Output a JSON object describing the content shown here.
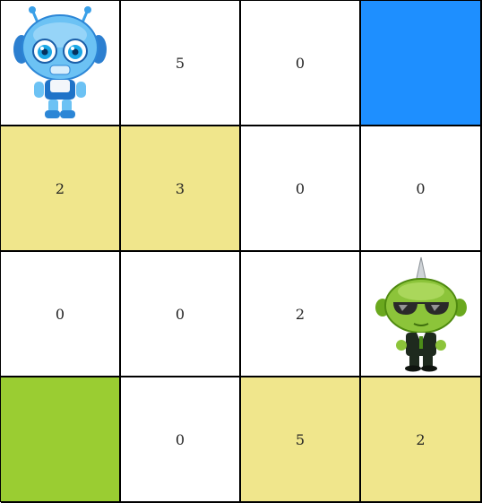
{
  "colors": {
    "white": "#ffffff",
    "sand": "#f0e68c",
    "blue": "#1e8fff",
    "green": "#9acd32"
  },
  "grid": [
    [
      {
        "value": "",
        "color": "white",
        "sprite": "blue-robot"
      },
      {
        "value": "5",
        "color": "white"
      },
      {
        "value": "0",
        "color": "white"
      },
      {
        "value": "",
        "color": "blue"
      }
    ],
    [
      {
        "value": "2",
        "color": "sand"
      },
      {
        "value": "3",
        "color": "sand"
      },
      {
        "value": "0",
        "color": "white"
      },
      {
        "value": "0",
        "color": "white"
      }
    ],
    [
      {
        "value": "0",
        "color": "white"
      },
      {
        "value": "0",
        "color": "white"
      },
      {
        "value": "2",
        "color": "white"
      },
      {
        "value": "",
        "color": "white",
        "sprite": "green-alien"
      }
    ],
    [
      {
        "value": "",
        "color": "green"
      },
      {
        "value": "0",
        "color": "white"
      },
      {
        "value": "5",
        "color": "sand"
      },
      {
        "value": "2",
        "color": "sand"
      }
    ]
  ]
}
